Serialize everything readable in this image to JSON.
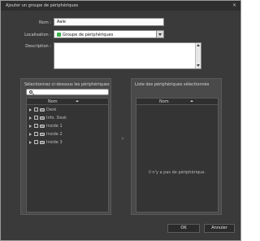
{
  "dialog": {
    "title": "Ajouter un groupe de périphériques",
    "close_glyph": "×"
  },
  "form": {
    "name_label": "Nom :",
    "name_required_mark": "",
    "name_value": "Aale",
    "location_label": "Localisation :",
    "location_value": "Groupe de périphériques",
    "description_label": "Description :",
    "description_value": ""
  },
  "left_panel": {
    "title": "Sélectionnez ci-dessous les périphériques",
    "search_placeholder": "",
    "column_header": "Nom",
    "rows": [
      {
        "label": "Desk",
        "checked": false
      },
      {
        "label": "Info. Desk",
        "checked": false
      },
      {
        "label": "Inside 1",
        "checked": false
      },
      {
        "label": "Inside 2",
        "checked": false
      },
      {
        "label": "Inside 3",
        "checked": false
      }
    ]
  },
  "right_panel": {
    "title": "Liste des périphériques sélectionnés",
    "column_header": "Nom",
    "empty_message": "Il n'y a pas de périphérique."
  },
  "buttons": {
    "ok": "OK",
    "cancel": "Annuler"
  },
  "colors": {
    "dialog_bg": "#3a3a3a",
    "panel_bg": "#4a4a4a",
    "list_bg": "#343434",
    "accent_required": "#ff7a00",
    "location_icon": "#3bb34a"
  },
  "icons": {
    "close": "close-icon",
    "location": "device-group-icon",
    "search": "search-icon",
    "sort": "sort-ascending-icon",
    "device": "camera-device-icon",
    "expander": "expand-arrow-icon",
    "transfer": "transfer-arrow-icon"
  }
}
